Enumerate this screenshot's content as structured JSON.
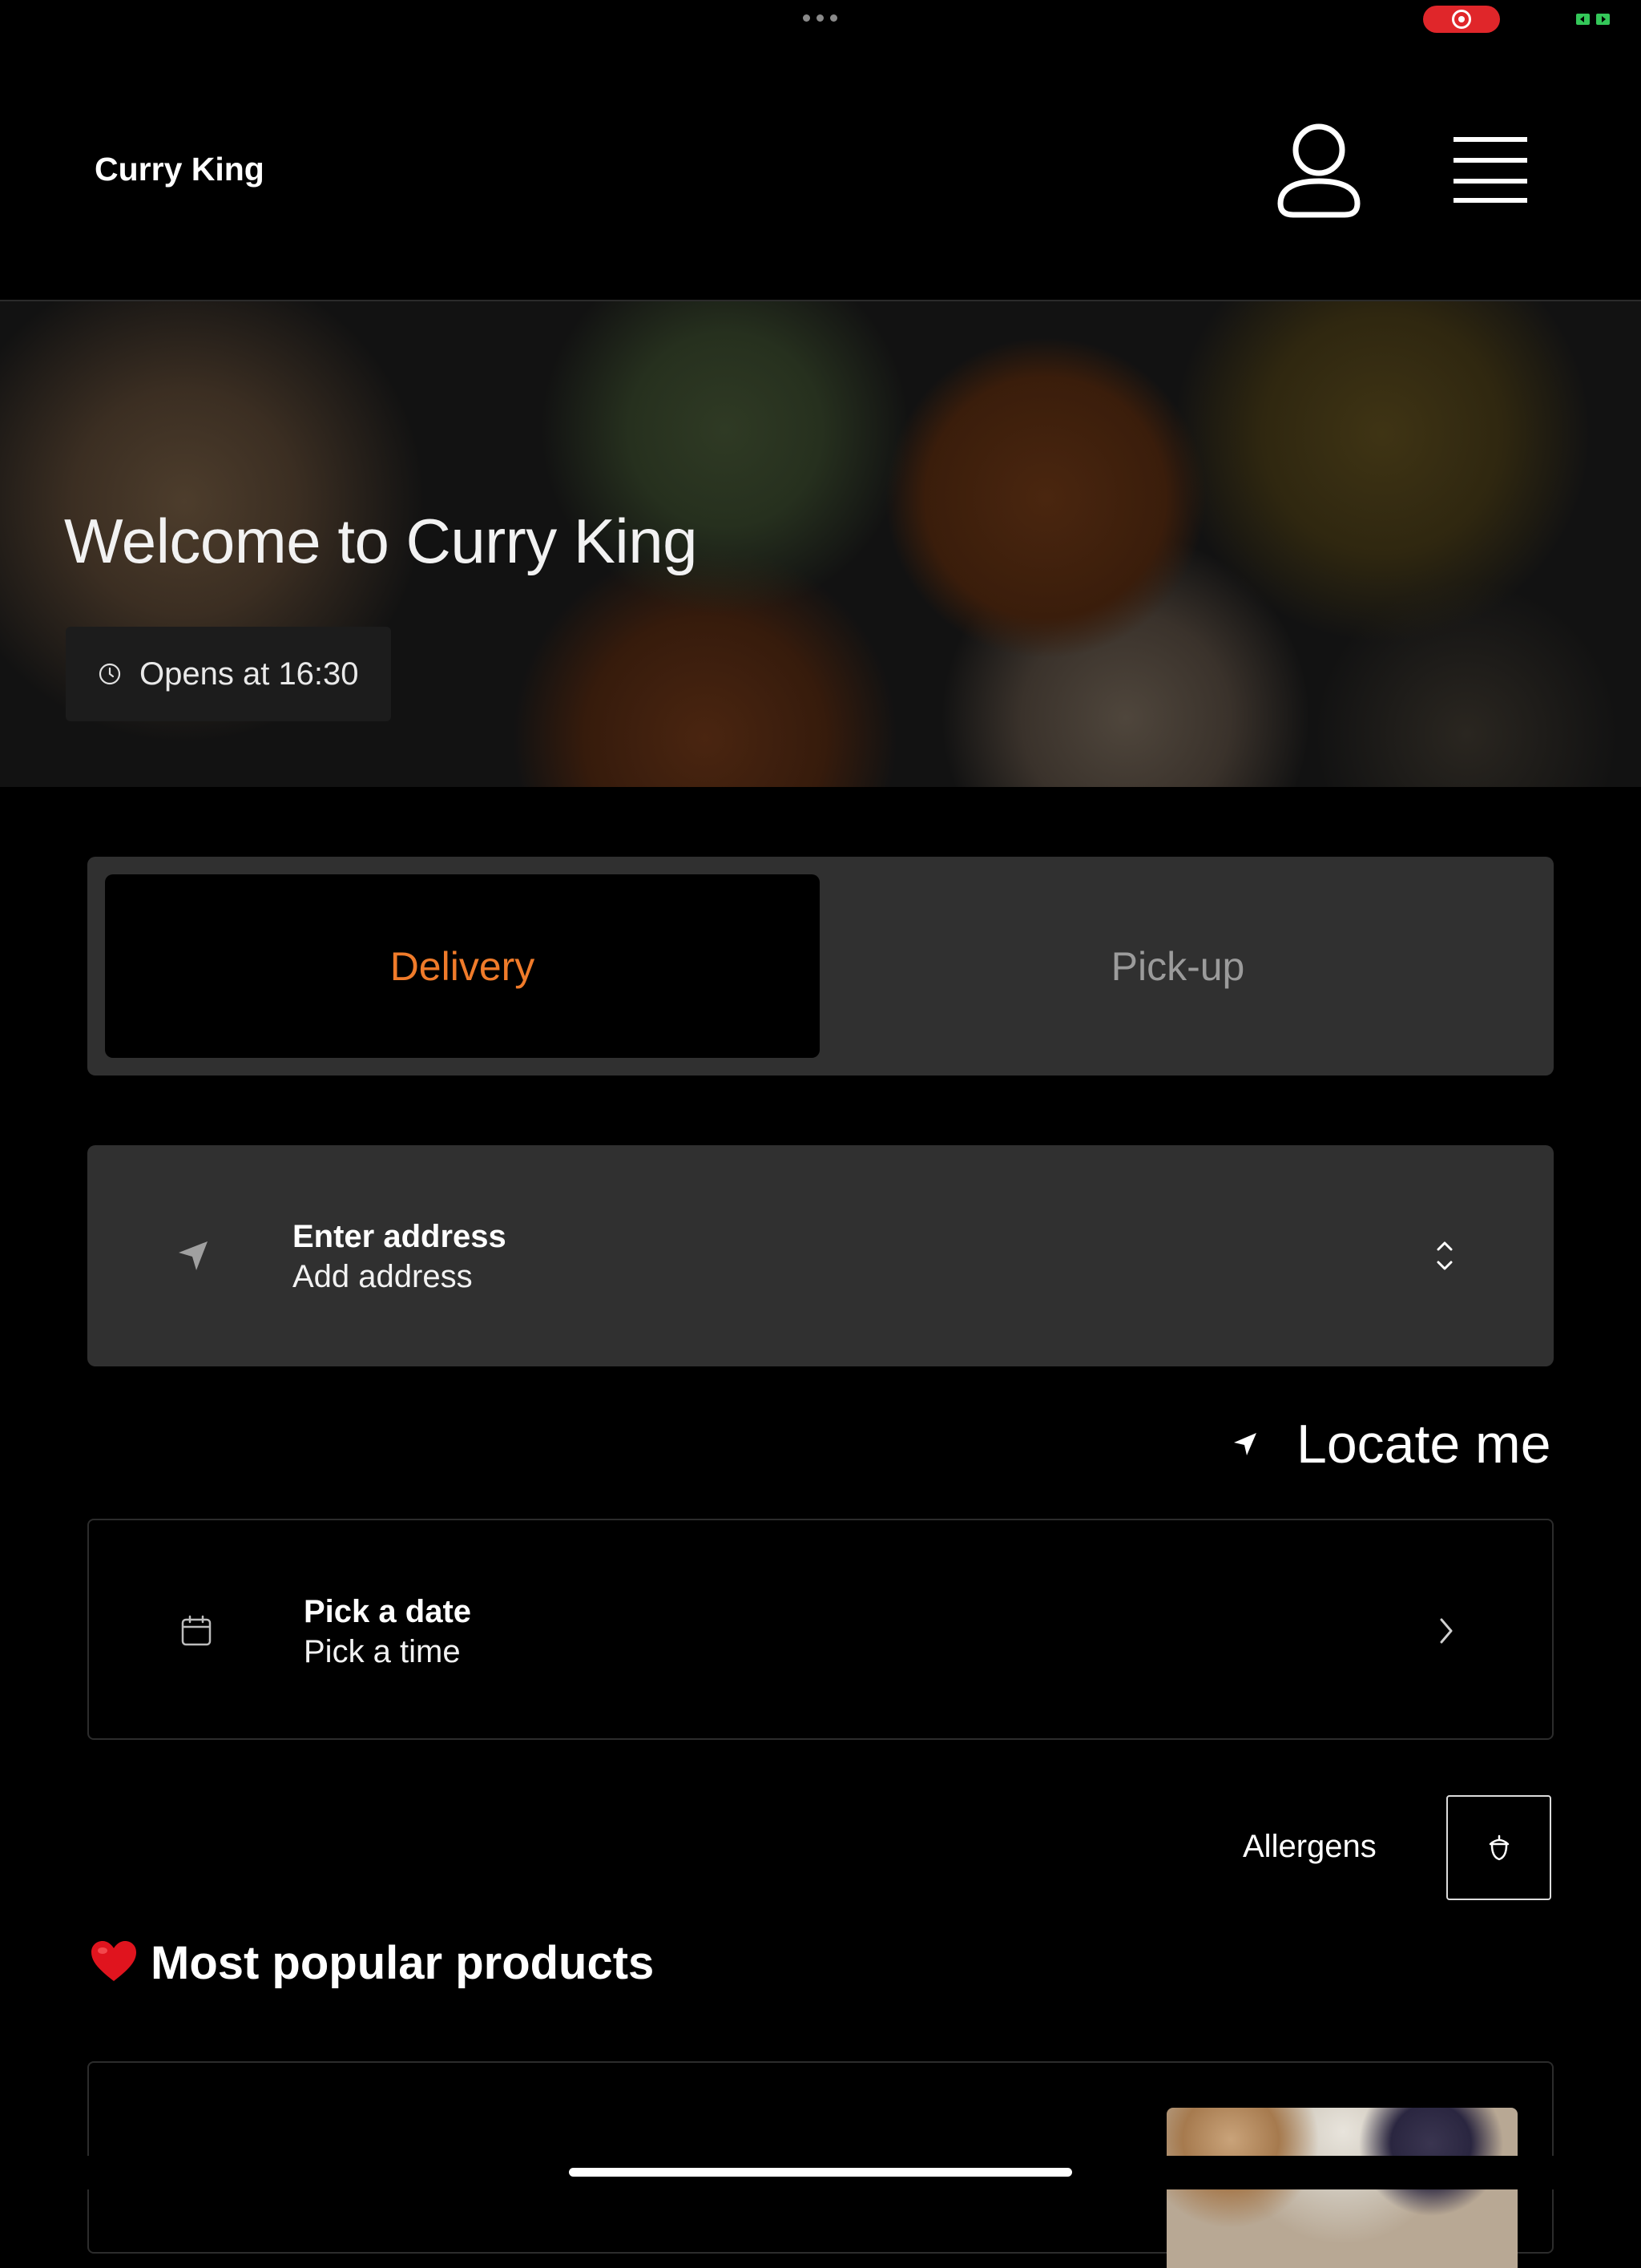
{
  "app": {
    "brand": "Curry King"
  },
  "header": {
    "account_icon": "person-icon",
    "menu_icon": "hamburger-menu-icon"
  },
  "hero": {
    "title": "Welcome to Curry King",
    "opens_text": "Opens at 16:30",
    "clock_icon": "clock-icon"
  },
  "order_mode": {
    "selected": "Delivery",
    "options": [
      "Delivery",
      "Pick-up"
    ],
    "active_color": "#f07b2a"
  },
  "address": {
    "title": "Enter address",
    "subtitle": "Add address"
  },
  "locate": {
    "label": "Locate me"
  },
  "schedule": {
    "title": "Pick a date",
    "subtitle": "Pick a time"
  },
  "allergens": {
    "label": "Allergens"
  },
  "popular": {
    "title": "Most popular products",
    "emoji": "heart-icon"
  }
}
